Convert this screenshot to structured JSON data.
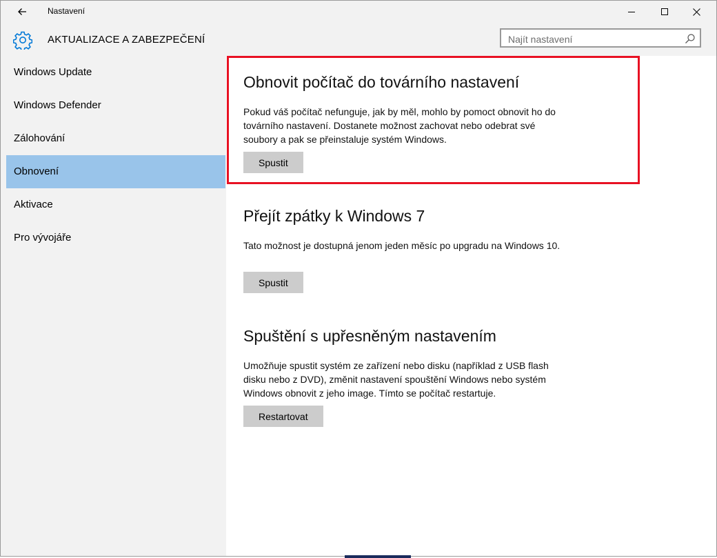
{
  "window": {
    "title": "Nastavení",
    "controls": [
      "minimize-icon",
      "maximize-icon",
      "close-icon"
    ]
  },
  "header": {
    "icon": "gear-icon",
    "section_title": "AKTUALIZACE A ZABEZPEČENÍ",
    "search_placeholder": "Najít nastavení"
  },
  "sidebar": {
    "items": [
      {
        "label": "Windows Update"
      },
      {
        "label": "Windows Defender"
      },
      {
        "label": "Zálohování"
      },
      {
        "label": "Obnovení",
        "active": true
      },
      {
        "label": "Aktivace"
      },
      {
        "label": "Pro vývojáře"
      }
    ]
  },
  "main": {
    "sections": [
      {
        "heading": "Obnovit počítač do továrního nastavení",
        "text": "Pokud váš počítač nefunguje, jak by měl, mohlo by pomoct obnovit ho do továrního nastavení. Dostanete možnost zachovat nebo odebrat své soubory a pak se přeinstaluje systém Windows.",
        "button": "Spustit",
        "highlighted": true
      },
      {
        "heading": "Přejít zpátky k Windows 7",
        "text": "Tato možnost je dostupná jenom jeden měsíc po upgradu na Windows 10.",
        "button": "Spustit"
      },
      {
        "heading": "Spuštění s upřesněným nastavením",
        "text": "Umožňuje spustit systém ze zařízení nebo disku (například z USB flash disku nebo z DVD), změnit nastavení spouštění Windows nebo systém Windows obnovit z jeho image. Tímto se počítač restartuje.",
        "button": "Restartovat"
      }
    ]
  },
  "colors": {
    "accent": "#0078d7",
    "nav_active": "#99c4ea",
    "highlight_border": "#e81123",
    "chrome_bg": "#f2f2f2",
    "button_bg": "#cccccc"
  }
}
